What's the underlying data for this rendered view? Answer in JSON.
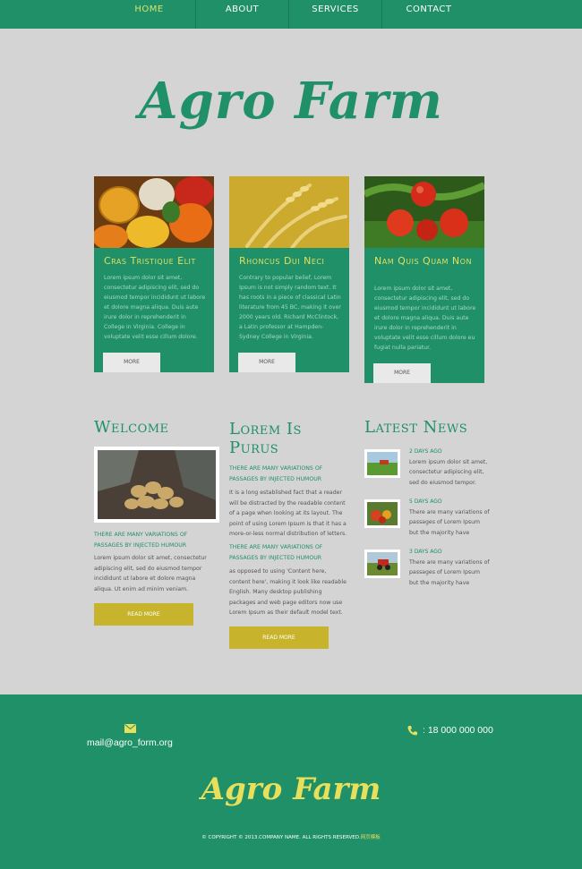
{
  "nav": {
    "items": [
      {
        "label": "HOME",
        "active": true
      },
      {
        "label": "ABOUT",
        "active": false
      },
      {
        "label": "SERVICES",
        "active": false
      },
      {
        "label": "CONTACT",
        "active": false
      }
    ]
  },
  "header": {
    "logo": "Agro Farm"
  },
  "cards": [
    {
      "title": "Cras Tristique Elit",
      "text": "Lorem ipsum dolor sit amet, consectetur adipiscing elit, sed do eiusmod tempor incididunt ut labore et dolore magna aliqua. Duis aute irure dolor in reprehenderit in College in Virginia. College in voluptate velit esse cillum dolore.",
      "button": "MORE",
      "image": "vegetables"
    },
    {
      "title": "Rhoncus Dui Neci",
      "text": "Contrary to popular belief, Lorem Ipsum is not simply random text. It has roots in a piece of classical Latin literature from 45 BC, making it over 2000 years old. Richard McClintock, a Latin professor at Hampden-Sydney College in Virginia.",
      "button": "MORE",
      "image": "wheat"
    },
    {
      "title": "Nam Quis Quam Non",
      "text": "Lorem ipsum dolor sit amet, consectetur adipiscing elit, sed do eiusmod tempor incididunt ut labore et dolore magna aliqua. Duis aute irure dolor in reprehenderit in voluptate velit esse cillum dolore eu fugiat nulla pariatur.",
      "button": "MORE",
      "image": "tomatoes"
    }
  ],
  "welcome": {
    "title": "Welcome",
    "subhead": "THERE ARE MANY VARIATIONS OF PASSAGES BY INJECTED HUMOUR",
    "text": "Lorem ipsum dolor sit amet, consectetur adipiscing elit, sed do eiusmod tempor incididunt ut labore et dolore magna aliqua. Ut enim ad minim veniam.",
    "button": "READ MORE"
  },
  "lorem": {
    "title": "Lorem Is Purus",
    "subhead1": "THERE ARE MANY VARIATIONS OF PASSAGES BY INJECTED HUMOUR",
    "text1": "It is a long established fact that a reader will be distracted by the readable content of a page when looking at its layout. The point of using Lorem Ipsum is that it has a more-or-less normal distribution of letters.",
    "subhead2": "THERE ARE MANY VARIATIONS OF PASSAGES BY INJECTED HUMOUR",
    "text2": "as opposed to using 'Content here, content here', making it look like readable English. Many desktop publishing packages and web page editors now use Lorem Ipsum as their default model text.",
    "button": "READ MORE"
  },
  "news": {
    "title": "Latest News",
    "items": [
      {
        "date": "2 DAYS AGO",
        "text": "Lorem ipsum dolor sit amet, consectetur adipiscing elit, sed do eiusmod tempor."
      },
      {
        "date": "5 DAYS AGO",
        "text": "There are many variations of passages of Lorem Ipsum but the majority have"
      },
      {
        "date": "3 DAYS AGO",
        "text": "There are many variations of passages of Lorem Ipsum but the majority have"
      }
    ]
  },
  "footer": {
    "email": "mail@agro_form.org",
    "phone": ": 18 000 000 000",
    "logo": "Agro Farm",
    "copyright": "© COPYRIGHT © 2013.COMPANY NAME. ALL RIGHTS RESERVED.",
    "copyright_accent": "网页模板"
  },
  "colors": {
    "brand_green": "#1f9068",
    "accent_yellow": "#e8df5a",
    "button_gold": "#c8b42c",
    "page_bg": "#d4d4d4"
  }
}
